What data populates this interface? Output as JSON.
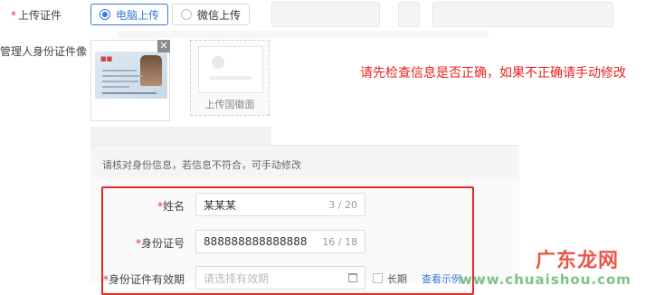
{
  "upload": {
    "label": "上传证件",
    "required_mark": "*",
    "options": [
      {
        "label": "电脑上传",
        "selected": true
      },
      {
        "label": "微信上传",
        "selected": false
      }
    ]
  },
  "id_photo": {
    "label": "管理人身份证件像",
    "close_symbol": "✕",
    "emblem_upload_label": "上传国徽面"
  },
  "notice": "请先检查信息是否正确，如果不正确请手动修改",
  "form": {
    "hint": "请核对身份信息，若信息不符合，可手动修改",
    "name": {
      "label": "姓名",
      "value": "某某某",
      "count": "3 / 20"
    },
    "id_number": {
      "label": "身份证号",
      "value": "888888888888888",
      "count": "16 / 18"
    },
    "validity": {
      "label": "身份证件有效期",
      "placeholder": "请选择有效期",
      "long_term_label": "长期",
      "example_link": "查看示例"
    }
  },
  "colors": {
    "accent": "#3a7bd5",
    "alert": "#e8231f"
  }
}
